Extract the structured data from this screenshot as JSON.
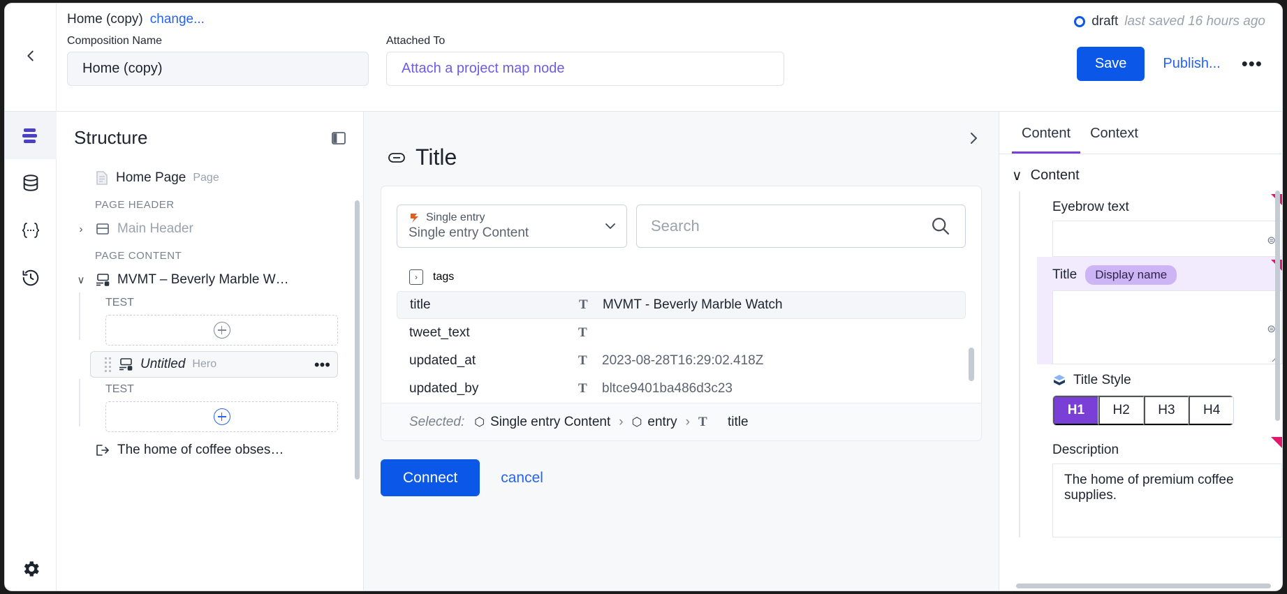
{
  "header": {
    "breadcrumb_title": "Home (copy)",
    "change_link": "change...",
    "composition_label": "Composition Name",
    "composition_value": "Home (copy)",
    "attached_label": "Attached To",
    "attached_placeholder": "Attach a project map node",
    "status": "draft",
    "last_saved": "last saved 16 hours ago",
    "save_label": "Save",
    "publish_label": "Publish...",
    "more_label": "•••",
    "accent_blue": "#0b57e8",
    "link_blue": "#2563f0",
    "purple": "#6c5ce7"
  },
  "rail": {
    "items": [
      {
        "name": "structure-icon"
      },
      {
        "name": "data-icon"
      },
      {
        "name": "variables-icon"
      },
      {
        "name": "history-icon"
      }
    ],
    "settings": "settings-gear-icon"
  },
  "structure": {
    "title": "Structure",
    "page": {
      "label": "Home Page",
      "type": "Page"
    },
    "sections": [
      {
        "heading": "PAGE HEADER",
        "rows": [
          {
            "label": "Main Header",
            "type": "",
            "muted": true,
            "chevron": "›"
          }
        ]
      },
      {
        "heading": "PAGE CONTENT",
        "rows": [
          {
            "label": "MVMT – Beverly Marble W…",
            "type": "",
            "muted": false,
            "chevron": "∨"
          }
        ]
      }
    ],
    "slot_label": "TEST",
    "selected_row": {
      "label": "Untitled",
      "type": "Hero",
      "chevron": "∨",
      "more": "•••"
    },
    "footer_row": {
      "label": "The home of coffee obses…"
    }
  },
  "center": {
    "title": "Title",
    "expand_icon": "›",
    "selector": {
      "top_label": "Single entry",
      "bottom_label": "Single entry Content",
      "chevron": "∨"
    },
    "search_placeholder": "Search",
    "search_value": "",
    "group_row": {
      "label": "tags",
      "marker": "›"
    },
    "fields": [
      {
        "name": "title",
        "type": "T",
        "value": "MVMT - Beverly Marble Watch",
        "selected": true
      },
      {
        "name": "tweet_text",
        "type": "T",
        "value": "",
        "selected": false
      },
      {
        "name": "updated_at",
        "type": "T",
        "value": "2023-08-28T16:29:02.418Z",
        "selected": false
      },
      {
        "name": "updated_by",
        "type": "T",
        "value": "bltce9401ba486d3c23",
        "selected": false
      }
    ],
    "selected_bar": {
      "label": "Selected:",
      "path": [
        {
          "icon": "⬡",
          "text": "Single entry Content"
        },
        {
          "icon": "⬡",
          "text": "entry"
        },
        {
          "icon": "T",
          "text": "title"
        }
      ],
      "separator": "›"
    },
    "connect_label": "Connect",
    "cancel_label": "cancel"
  },
  "right": {
    "tabs": [
      {
        "label": "Content",
        "active": true
      },
      {
        "label": "Context",
        "active": false
      }
    ],
    "section_label": "Content",
    "section_chevron": "∨",
    "fields": [
      {
        "label": "Eyebrow text",
        "badge": "",
        "value": "",
        "highlight": false,
        "tall": false,
        "flag": true,
        "chip": "⊜"
      },
      {
        "label": "Title",
        "badge": "Display name",
        "value": "",
        "highlight": true,
        "tall": true,
        "flag": true,
        "chip": "⊜"
      }
    ],
    "style": {
      "label": "Title Style",
      "options": [
        "H1",
        "H2",
        "H3",
        "H4"
      ],
      "selected": "H1",
      "accent": "#7a3fd6"
    },
    "description": {
      "label": "Description",
      "value": "The home of premium coffee supplies.",
      "flag": true
    }
  }
}
